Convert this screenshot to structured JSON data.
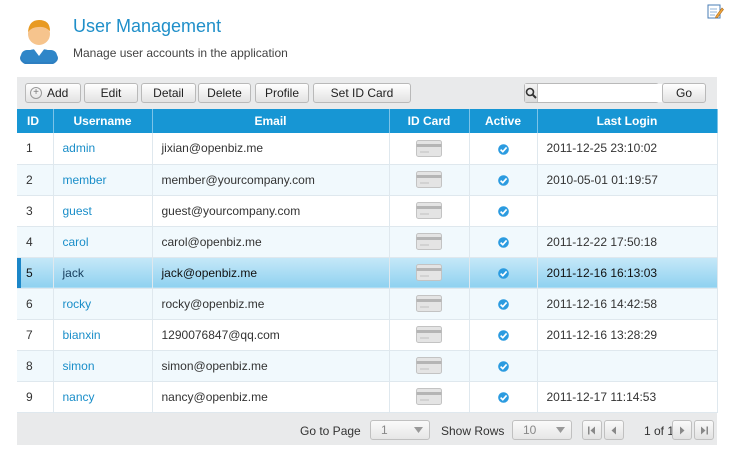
{
  "header": {
    "title": "User Management",
    "subtitle": "Manage user accounts in the application"
  },
  "toolbar": {
    "add": "Add",
    "edit": "Edit",
    "detail": "Detail",
    "delete": "Delete",
    "profile": "Profile",
    "set_id_card": "Set ID Card",
    "search_value": "",
    "go": "Go"
  },
  "columns": [
    "ID",
    "Username",
    "Email",
    "ID Card",
    "Active",
    "Last Login"
  ],
  "rows": [
    {
      "id": "1",
      "username": "admin",
      "email": "jixian@openbiz.me",
      "last_login": "2011-12-25 23:10:02",
      "active": true
    },
    {
      "id": "2",
      "username": "member",
      "email": "member@yourcompany.com",
      "last_login": "2010-05-01 01:19:57",
      "active": true
    },
    {
      "id": "3",
      "username": "guest",
      "email": "guest@yourcompany.com",
      "last_login": "",
      "active": true
    },
    {
      "id": "4",
      "username": "carol",
      "email": "carol@openbiz.me",
      "last_login": "2011-12-22 17:50:18",
      "active": true
    },
    {
      "id": "5",
      "username": "jack",
      "email": "jack@openbiz.me",
      "last_login": "2011-12-16 16:13:03",
      "active": true,
      "selected": true
    },
    {
      "id": "6",
      "username": "rocky",
      "email": "rocky@openbiz.me",
      "last_login": "2011-12-16 14:42:58",
      "active": true
    },
    {
      "id": "7",
      "username": "bianxin",
      "email": "1290076847@qq.com",
      "last_login": "2011-12-16 13:28:29",
      "active": true
    },
    {
      "id": "8",
      "username": "simon",
      "email": "simon@openbiz.me",
      "last_login": "",
      "active": true
    },
    {
      "id": "9",
      "username": "nancy",
      "email": "nancy@openbiz.me",
      "last_login": "2011-12-17 11:14:53",
      "active": true
    }
  ],
  "pager": {
    "go_to_page_label": "Go to Page",
    "page_value": "1",
    "show_rows_label": "Show Rows",
    "rows_value": "10",
    "count_text": "1 of 1"
  },
  "icons": {
    "page": "user-avatar-icon",
    "edit_page": "edit-page-icon",
    "search": "search-icon",
    "card": "id-card-icon",
    "active": "check-icon"
  },
  "colors": {
    "accent": "#1796d4",
    "title": "#1f8fc9",
    "link": "#1a8ec9",
    "selected_row": "#8fd1f0"
  }
}
